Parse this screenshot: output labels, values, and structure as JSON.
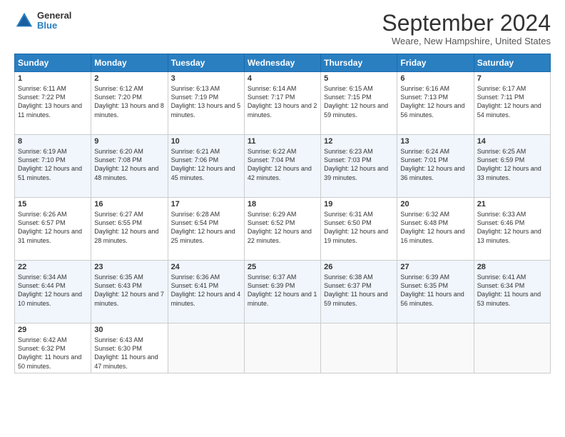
{
  "header": {
    "logo_line1": "General",
    "logo_line2": "Blue",
    "title": "September 2024",
    "location": "Weare, New Hampshire, United States"
  },
  "days_of_week": [
    "Sunday",
    "Monday",
    "Tuesday",
    "Wednesday",
    "Thursday",
    "Friday",
    "Saturday"
  ],
  "weeks": [
    [
      {
        "day": "1",
        "sunrise": "6:11 AM",
        "sunset": "7:22 PM",
        "daylight": "13 hours and 11 minutes."
      },
      {
        "day": "2",
        "sunrise": "6:12 AM",
        "sunset": "7:20 PM",
        "daylight": "13 hours and 8 minutes."
      },
      {
        "day": "3",
        "sunrise": "6:13 AM",
        "sunset": "7:19 PM",
        "daylight": "13 hours and 5 minutes."
      },
      {
        "day": "4",
        "sunrise": "6:14 AM",
        "sunset": "7:17 PM",
        "daylight": "13 hours and 2 minutes."
      },
      {
        "day": "5",
        "sunrise": "6:15 AM",
        "sunset": "7:15 PM",
        "daylight": "12 hours and 59 minutes."
      },
      {
        "day": "6",
        "sunrise": "6:16 AM",
        "sunset": "7:13 PM",
        "daylight": "12 hours and 56 minutes."
      },
      {
        "day": "7",
        "sunrise": "6:17 AM",
        "sunset": "7:11 PM",
        "daylight": "12 hours and 54 minutes."
      }
    ],
    [
      {
        "day": "8",
        "sunrise": "6:19 AM",
        "sunset": "7:10 PM",
        "daylight": "12 hours and 51 minutes."
      },
      {
        "day": "9",
        "sunrise": "6:20 AM",
        "sunset": "7:08 PM",
        "daylight": "12 hours and 48 minutes."
      },
      {
        "day": "10",
        "sunrise": "6:21 AM",
        "sunset": "7:06 PM",
        "daylight": "12 hours and 45 minutes."
      },
      {
        "day": "11",
        "sunrise": "6:22 AM",
        "sunset": "7:04 PM",
        "daylight": "12 hours and 42 minutes."
      },
      {
        "day": "12",
        "sunrise": "6:23 AM",
        "sunset": "7:03 PM",
        "daylight": "12 hours and 39 minutes."
      },
      {
        "day": "13",
        "sunrise": "6:24 AM",
        "sunset": "7:01 PM",
        "daylight": "12 hours and 36 minutes."
      },
      {
        "day": "14",
        "sunrise": "6:25 AM",
        "sunset": "6:59 PM",
        "daylight": "12 hours and 33 minutes."
      }
    ],
    [
      {
        "day": "15",
        "sunrise": "6:26 AM",
        "sunset": "6:57 PM",
        "daylight": "12 hours and 31 minutes."
      },
      {
        "day": "16",
        "sunrise": "6:27 AM",
        "sunset": "6:55 PM",
        "daylight": "12 hours and 28 minutes."
      },
      {
        "day": "17",
        "sunrise": "6:28 AM",
        "sunset": "6:54 PM",
        "daylight": "12 hours and 25 minutes."
      },
      {
        "day": "18",
        "sunrise": "6:29 AM",
        "sunset": "6:52 PM",
        "daylight": "12 hours and 22 minutes."
      },
      {
        "day": "19",
        "sunrise": "6:31 AM",
        "sunset": "6:50 PM",
        "daylight": "12 hours and 19 minutes."
      },
      {
        "day": "20",
        "sunrise": "6:32 AM",
        "sunset": "6:48 PM",
        "daylight": "12 hours and 16 minutes."
      },
      {
        "day": "21",
        "sunrise": "6:33 AM",
        "sunset": "6:46 PM",
        "daylight": "12 hours and 13 minutes."
      }
    ],
    [
      {
        "day": "22",
        "sunrise": "6:34 AM",
        "sunset": "6:44 PM",
        "daylight": "12 hours and 10 minutes."
      },
      {
        "day": "23",
        "sunrise": "6:35 AM",
        "sunset": "6:43 PM",
        "daylight": "12 hours and 7 minutes."
      },
      {
        "day": "24",
        "sunrise": "6:36 AM",
        "sunset": "6:41 PM",
        "daylight": "12 hours and 4 minutes."
      },
      {
        "day": "25",
        "sunrise": "6:37 AM",
        "sunset": "6:39 PM",
        "daylight": "12 hours and 1 minute."
      },
      {
        "day": "26",
        "sunrise": "6:38 AM",
        "sunset": "6:37 PM",
        "daylight": "11 hours and 59 minutes."
      },
      {
        "day": "27",
        "sunrise": "6:39 AM",
        "sunset": "6:35 PM",
        "daylight": "11 hours and 56 minutes."
      },
      {
        "day": "28",
        "sunrise": "6:41 AM",
        "sunset": "6:34 PM",
        "daylight": "11 hours and 53 minutes."
      }
    ],
    [
      {
        "day": "29",
        "sunrise": "6:42 AM",
        "sunset": "6:32 PM",
        "daylight": "11 hours and 50 minutes."
      },
      {
        "day": "30",
        "sunrise": "6:43 AM",
        "sunset": "6:30 PM",
        "daylight": "11 hours and 47 minutes."
      },
      null,
      null,
      null,
      null,
      null
    ]
  ]
}
